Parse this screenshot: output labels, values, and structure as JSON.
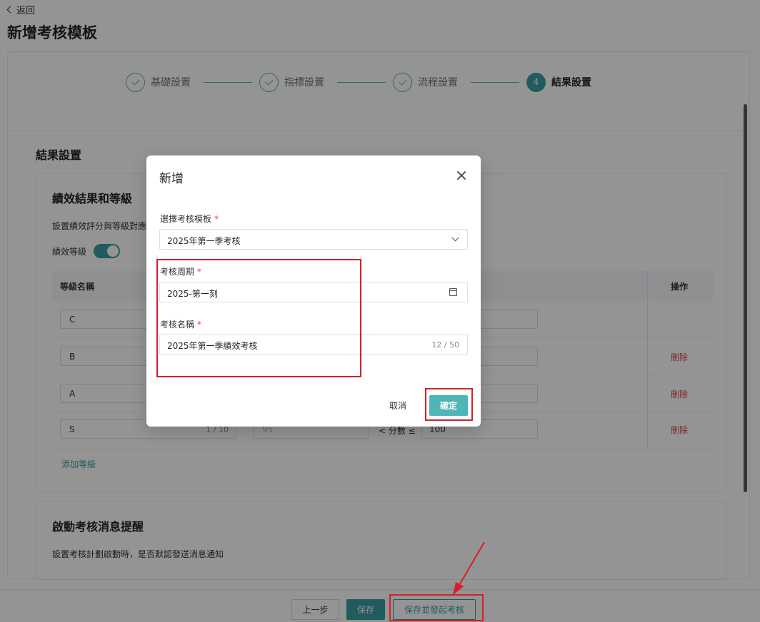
{
  "header": {
    "back_label": "返回",
    "title": "新增考核模板"
  },
  "steps": [
    {
      "label": "基礎設置",
      "state": "done"
    },
    {
      "label": "指標設置",
      "state": "done"
    },
    {
      "label": "流程設置",
      "state": "done"
    },
    {
      "label": "結果設置",
      "state": "active",
      "number": "4"
    }
  ],
  "result_section": {
    "title": "結果設置",
    "grade_card": {
      "title": "績效結果和等級",
      "description": "設置績效評分與等級對應",
      "toggle_label": "績效等級",
      "toggle_on": true,
      "columns": {
        "name": "等級名稱",
        "action": "操作"
      },
      "rows": [
        {
          "name": "C",
          "delete_label": ""
        },
        {
          "name": "B",
          "delete_label": "刪除"
        },
        {
          "name": "A",
          "delete_label": "刪除"
        },
        {
          "name": "S",
          "count": "1 / 10",
          "low": "95",
          "mid": "< 分數 ≤",
          "high": "100",
          "delete_label": "刪除"
        }
      ],
      "add_label": "添加等級"
    },
    "notify_card": {
      "title": "啟動考核消息提醒",
      "description": "設置考核計劃啟動時，是否默認發送消息通知"
    }
  },
  "footer": {
    "prev_label": "上一步",
    "save_label": "保存",
    "save_start_label": "保存並發起考核"
  },
  "modal": {
    "title": "新增",
    "template_label": "選擇考核模板",
    "template_value": "2025年第一季考核",
    "period_label": "考核周期",
    "period_value": "2025-第一刻",
    "name_label": "考核名稱",
    "name_value": "2025年第一季績效考核",
    "name_count": "12 / 50",
    "required_mark": "*",
    "cancel_label": "取消",
    "ok_label": "確定"
  },
  "colors": {
    "accent": "#3a9ea0",
    "danger": "#d54941",
    "annotation": "#d61f26"
  }
}
